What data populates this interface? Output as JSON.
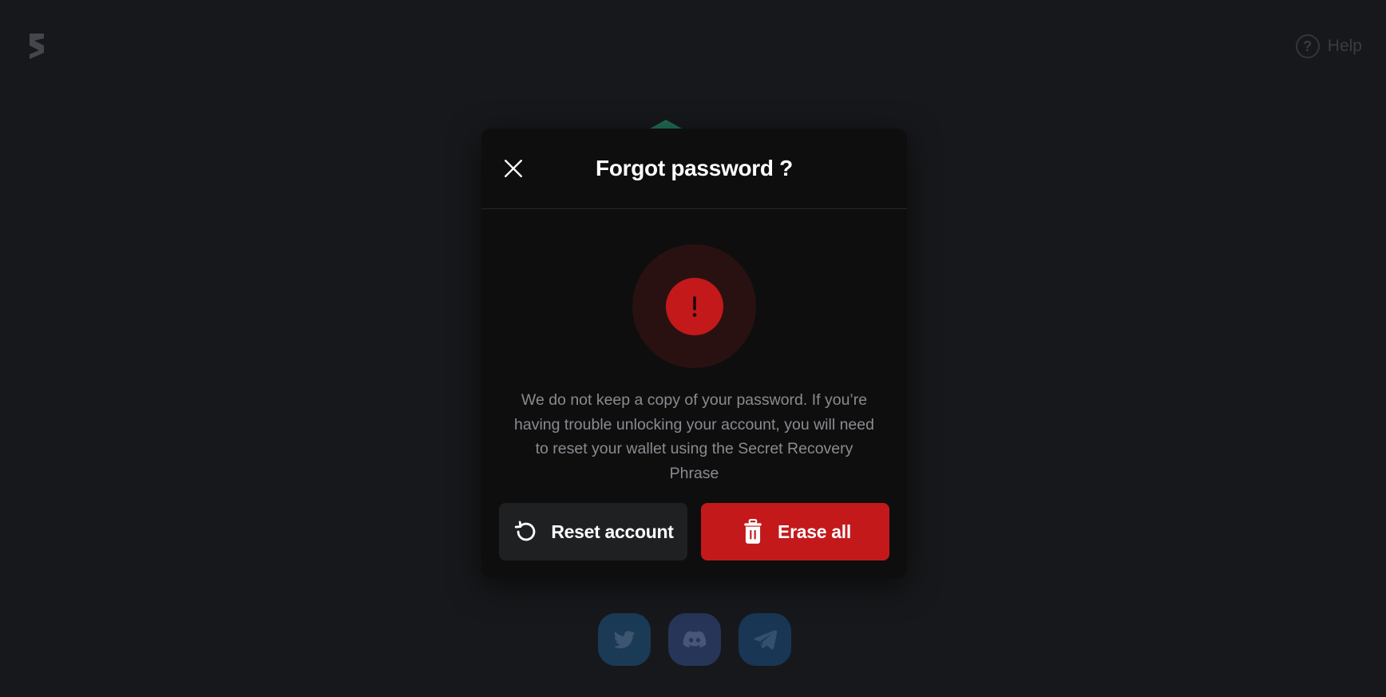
{
  "background": {
    "logo_icon": "brand-s-logo-icon",
    "help": {
      "icon": "question-circle-icon",
      "glyph": "?",
      "label": "Help"
    },
    "socials": [
      {
        "name": "twitter",
        "icon": "twitter-icon"
      },
      {
        "name": "discord",
        "icon": "discord-icon"
      },
      {
        "name": "telegram",
        "icon": "telegram-icon"
      }
    ]
  },
  "modal": {
    "title": "Forgot password ?",
    "close_icon": "close-icon",
    "alert_icon": "exclamation-icon",
    "message": "We do not keep a copy of your password. If you’re having trouble unlocking your account, you will need to reset your wallet using the Secret Recovery Phrase",
    "buttons": {
      "reset": {
        "label": "Reset account",
        "icon": "refresh-icon"
      },
      "erase": {
        "label": "Erase all",
        "icon": "trash-icon"
      }
    }
  },
  "colors": {
    "danger": "#c3191b",
    "modal_bg": "#0e0e0f",
    "page_bg": "#17181b"
  }
}
